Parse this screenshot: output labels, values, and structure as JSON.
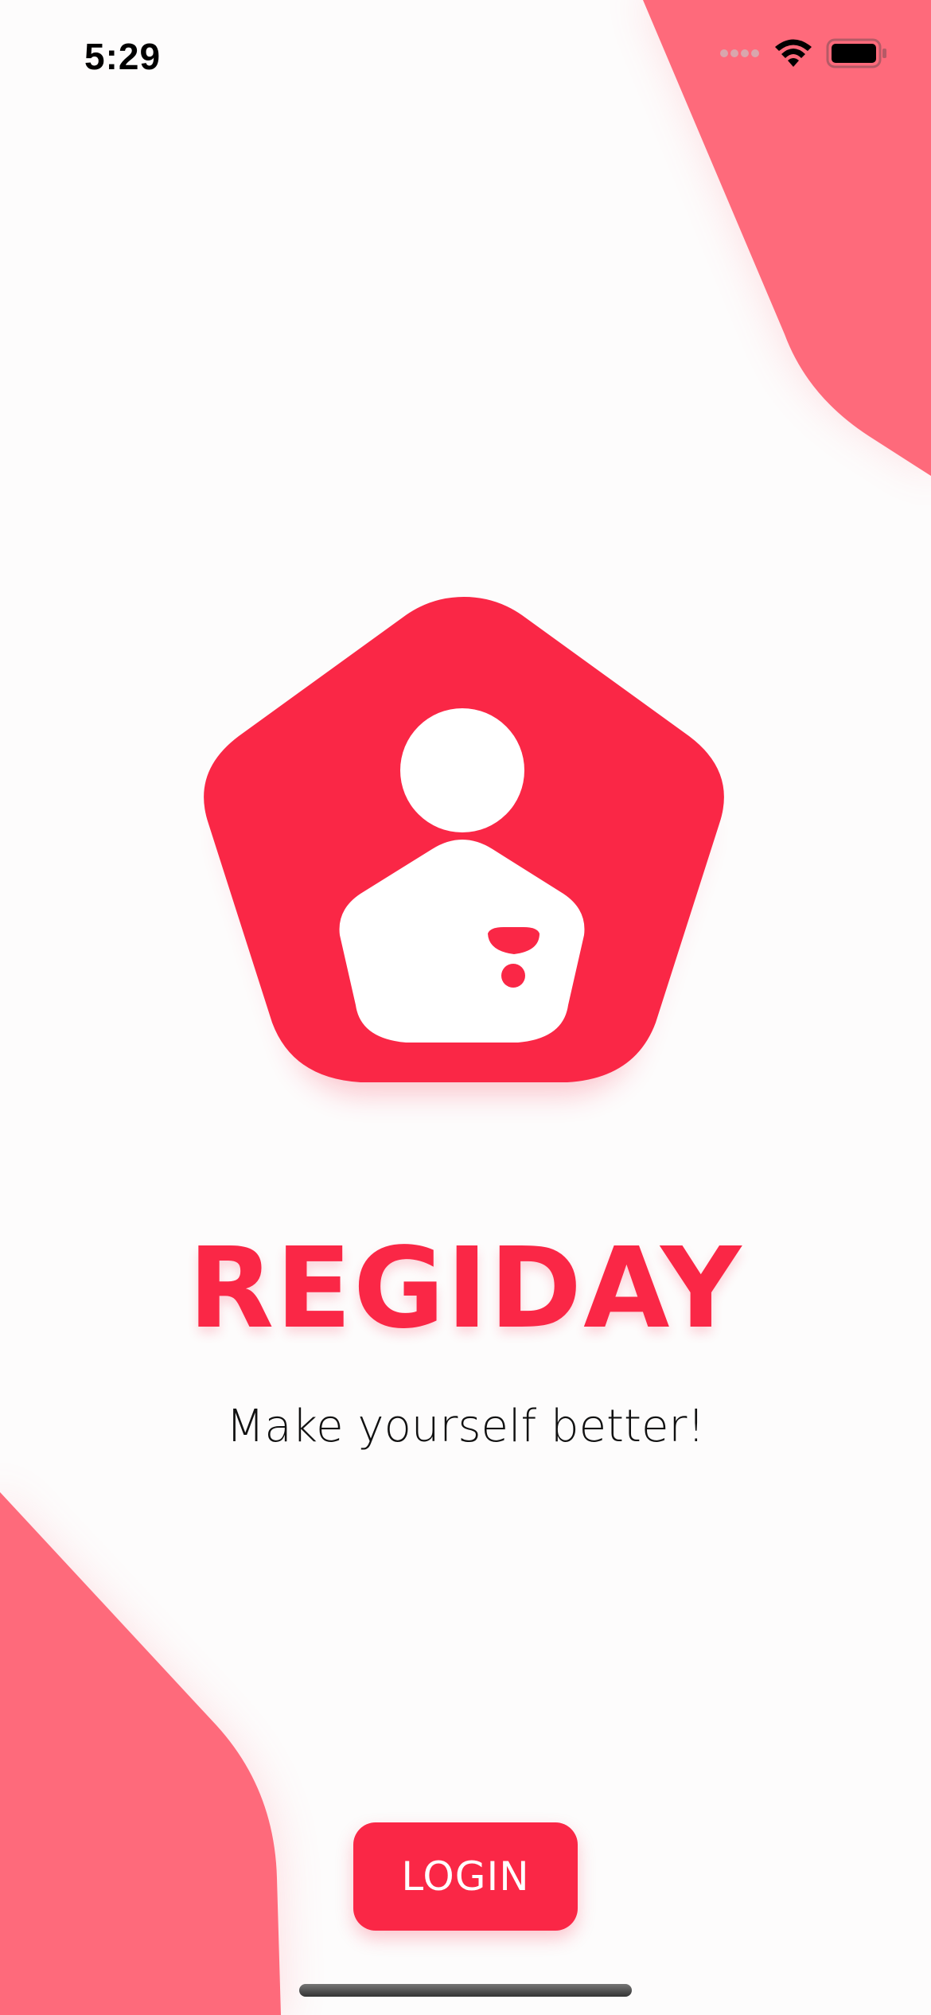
{
  "status_bar": {
    "time": "5:29"
  },
  "branding": {
    "app_name": "REGIDAY",
    "tagline": "Make yourself better!",
    "logo_icon": "person-pentagon-icon"
  },
  "actions": {
    "login_label": "LOGIN"
  },
  "colors": {
    "brand_red": "#fa2746",
    "decor_pink": "#fe6a7b",
    "background": "#fdfcfc"
  }
}
